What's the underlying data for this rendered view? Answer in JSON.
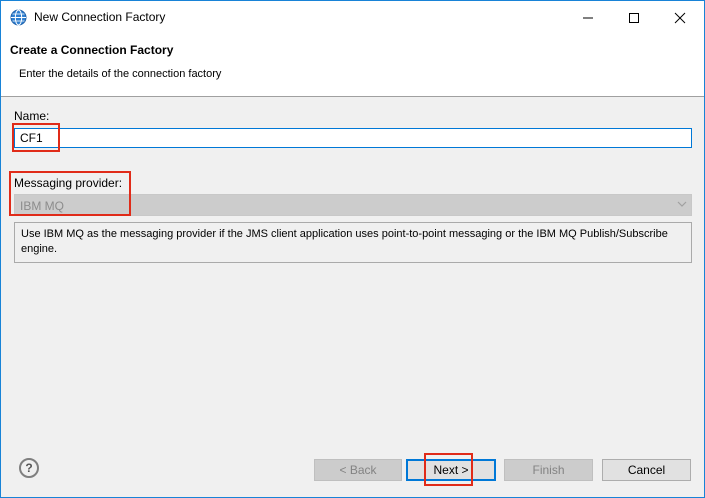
{
  "window": {
    "title": "New Connection Factory"
  },
  "header": {
    "title": "Create a Connection Factory",
    "subtitle": "Enter the details of the connection factory"
  },
  "form": {
    "name_label": "Name:",
    "name_value": "CF1",
    "provider_label": "Messaging provider:",
    "provider_value": "IBM MQ",
    "description": "Use IBM MQ as the messaging provider if the JMS client application uses point-to-point messaging or the IBM MQ Publish/Subscribe engine."
  },
  "buttons": {
    "help": "?",
    "back": "< Back",
    "next": "Next >",
    "finish": "Finish",
    "cancel": "Cancel"
  },
  "colors": {
    "accent": "#0078d7",
    "highlight": "#e02b19"
  }
}
